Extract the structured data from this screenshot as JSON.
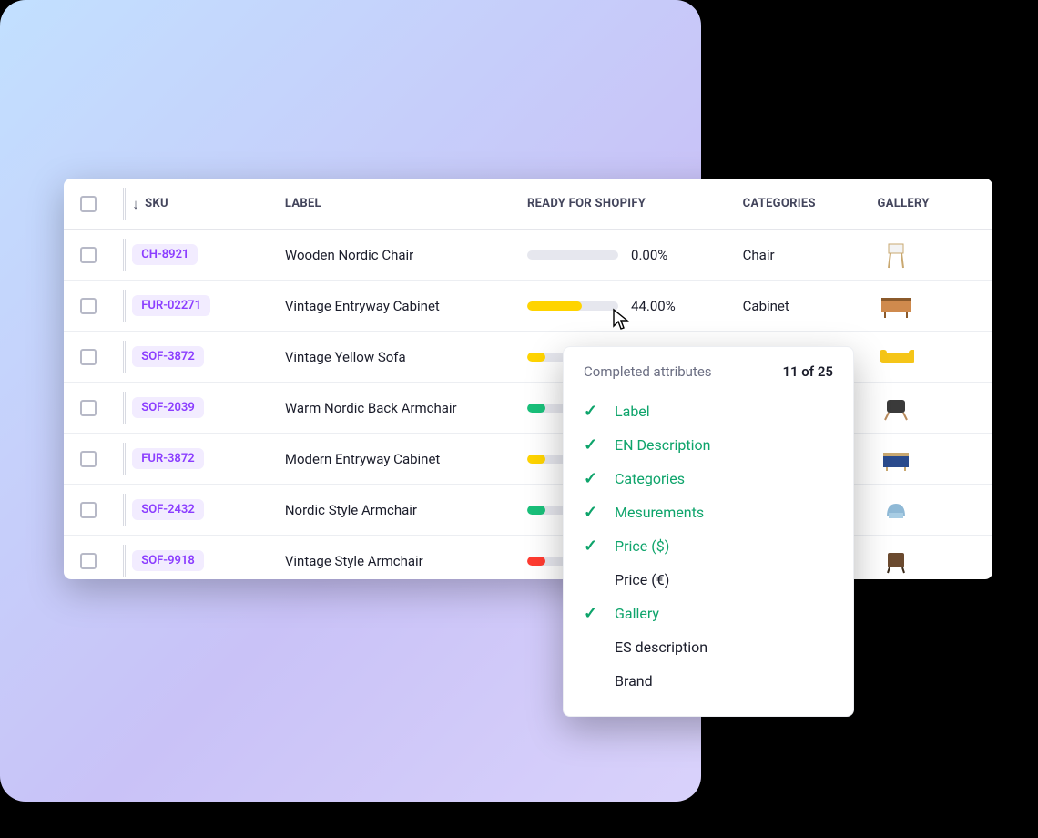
{
  "columns": {
    "sku": "SKU",
    "label": "LABEL",
    "ready": "READY FOR SHOPIFY",
    "categories": "CATEGORIES",
    "gallery": "GALLERY"
  },
  "rows": [
    {
      "sku": "CH-8921",
      "label": "Wooden Nordic Chair",
      "readyPct": 0.0,
      "readyText": "0.00%",
      "category": "Chair",
      "barColor": "#e6e7ee",
      "barFill": 0,
      "thumb": "chair-silhouette"
    },
    {
      "sku": "FUR-02271",
      "label": "Vintage Entryway Cabinet",
      "readyPct": 44.0,
      "readyText": "44.00%",
      "category": "Cabinet",
      "barColor": "#ffd400",
      "barFill": 60,
      "thumb": "cabinet-wood"
    },
    {
      "sku": "SOF-3872",
      "label": "Vintage Yellow Sofa",
      "readyPct": null,
      "readyText": "",
      "category": "",
      "barColor": "#ffd400",
      "barFill": 20,
      "thumb": "sofa-yellow"
    },
    {
      "sku": "SOF-2039",
      "label": "Warm Nordic Back Armchair",
      "readyPct": null,
      "readyText": "",
      "category": "",
      "barColor": "#19c07a",
      "barFill": 20,
      "thumb": "armchair-dark"
    },
    {
      "sku": "FUR-3872",
      "label": "Modern Entryway Cabinet",
      "readyPct": null,
      "readyText": "",
      "category": "",
      "barColor": "#ffd400",
      "barFill": 20,
      "thumb": "cabinet-blue"
    },
    {
      "sku": "SOF-2432",
      "label": "Nordic Style Armchair",
      "readyPct": null,
      "readyText": "",
      "category": "",
      "barColor": "#19c07a",
      "barFill": 20,
      "thumb": "armchair-blue"
    },
    {
      "sku": "SOF-9918",
      "label": "Vintage Style Armchair",
      "readyPct": null,
      "readyText": "",
      "category": "",
      "barColor": "#ff3b30",
      "barFill": 20,
      "thumb": "armchair-brown"
    }
  ],
  "popover": {
    "title": "Completed attributes",
    "count": "11 of 25",
    "items": [
      {
        "label": "Label",
        "done": true
      },
      {
        "label": "EN Description",
        "done": true
      },
      {
        "label": "Categories",
        "done": true
      },
      {
        "label": "Mesurements",
        "done": true
      },
      {
        "label": "Price ($)",
        "done": true
      },
      {
        "label": "Price (€)",
        "done": false
      },
      {
        "label": "Gallery",
        "done": true
      },
      {
        "label": "ES description",
        "done": false
      },
      {
        "label": "Brand",
        "done": false
      }
    ]
  }
}
